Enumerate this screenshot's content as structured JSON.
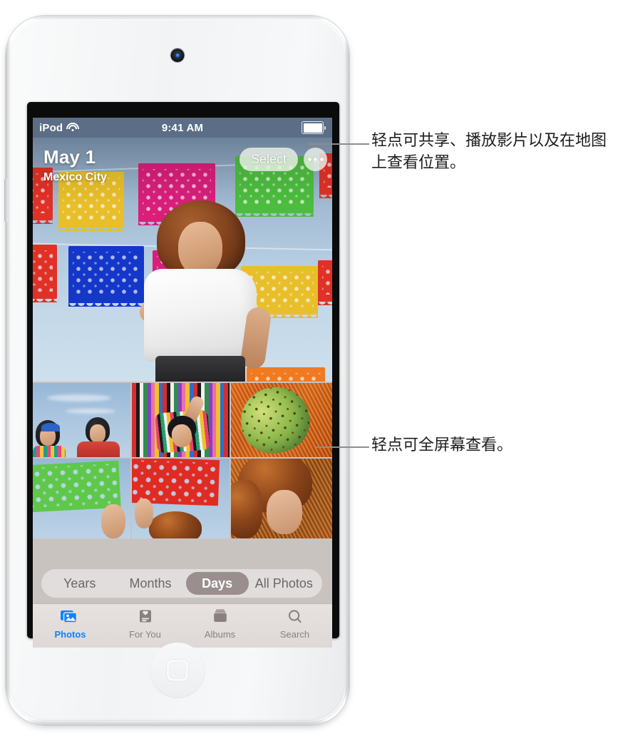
{
  "device": {
    "name": "ipod-touch",
    "camera_label": "front-camera",
    "home_button_label": "home-button",
    "volume_button_label": "volume-button"
  },
  "statusbar": {
    "carrier": "iPod",
    "wifi_icon": "wifi-icon",
    "time": "9:41 AM",
    "battery_icon": "battery-full-icon"
  },
  "hero": {
    "title": "May 1",
    "subtitle": "Mexico City",
    "select_label": "Select",
    "more_icon": "ellipsis-icon"
  },
  "segmented_control": {
    "options": [
      "Years",
      "Months",
      "Days",
      "All Photos"
    ],
    "selected": "Days"
  },
  "tabbar": {
    "items": [
      {
        "label": "Photos",
        "icon": "photos-icon",
        "active": true
      },
      {
        "label": "For You",
        "icon": "for-you-icon",
        "active": false
      },
      {
        "label": "Albums",
        "icon": "albums-icon",
        "active": false
      },
      {
        "label": "Search",
        "icon": "search-icon",
        "active": false
      }
    ]
  },
  "callouts": [
    {
      "text": "轻点可共享、播放影片以及在地图上查看位置。"
    },
    {
      "text": "轻点可全屏幕查看。"
    }
  ],
  "colors": {
    "accent": "#0a84ff",
    "statusbar_bg": "#5b6e86",
    "segment_selected_bg": "#9a8e8e",
    "tabbar_bg": "#e7e2e0",
    "callout_text": "#1d1d1f",
    "leader_line": "#8e8e8e"
  }
}
